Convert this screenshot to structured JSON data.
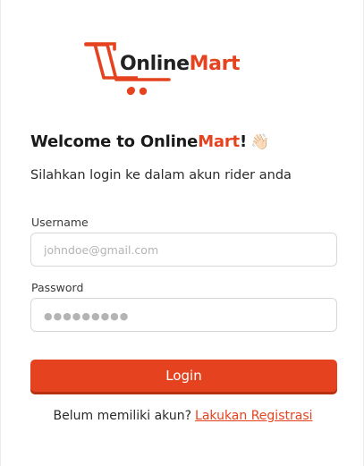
{
  "brand": {
    "name_part1": "Online",
    "name_part2": "Mart",
    "accent_color": "#e5431f",
    "text_color": "#222222",
    "logo_icon": "shopping-cart-icon"
  },
  "welcome": {
    "prefix": "Welcome to Online",
    "accent": "Mart",
    "suffix": "!",
    "emoji": "👋🏻"
  },
  "subtitle": "Silahkan login ke dalam akun rider anda",
  "form": {
    "username_label": "Username",
    "username_placeholder": "johndoe@gmail.com",
    "username_value": "",
    "password_label": "Password",
    "password_placeholder": "●●●●●●●●●",
    "password_value": "",
    "submit_label": "Login"
  },
  "register": {
    "prompt": "Belum memiliki akun?",
    "link_label": "Lakukan Registrasi"
  }
}
